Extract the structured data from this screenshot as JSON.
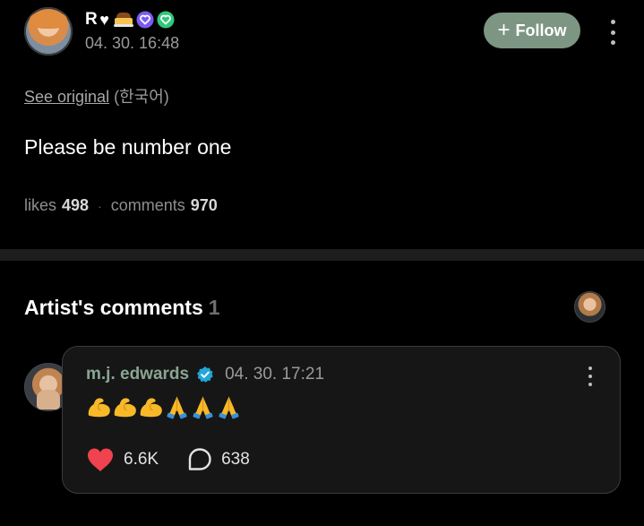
{
  "post": {
    "author_name": "R",
    "author_glyph": "♥",
    "timestamp": "04. 30. 16:48",
    "follow_label": "Follow",
    "follow_plus": "+",
    "see_original": "See original",
    "original_language": "(한국어)",
    "text": "Please be number one",
    "likes_label": "likes",
    "likes_value": "498",
    "separator": "·",
    "comments_label": "comments",
    "comments_value": "970"
  },
  "artist_comments": {
    "title": "Artist's comments",
    "count": "1"
  },
  "comment": {
    "author_name": "m.j. edwards",
    "timestamp": "04. 30. 17:21",
    "emojis": [
      "flexed-biceps",
      "flexed-biceps",
      "flexed-biceps",
      "folded-hands",
      "folded-hands",
      "folded-hands"
    ],
    "likes_value": "6.6K",
    "replies_value": "638"
  },
  "colors": {
    "background": "#000000",
    "follow_button": "#7d9683",
    "commenter_name": "#8aa593",
    "heart": "#f0424f",
    "verified": "#22a6d8",
    "badge_purple": "#7b5cf0",
    "badge_green": "#31c77a"
  },
  "icons": {
    "post_badges": [
      "flan-icon",
      "heart-badge-purple-icon",
      "heart-badge-green-icon"
    ],
    "more": "more-vertical-icon",
    "verified": "verified-check-icon",
    "like": "heart-icon",
    "reply": "chat-bubble-icon"
  }
}
